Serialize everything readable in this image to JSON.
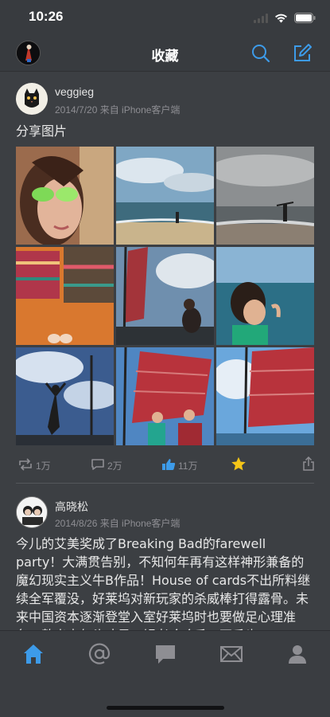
{
  "status_bar": {
    "time": "10:26"
  },
  "nav": {
    "title": "收藏"
  },
  "posts": [
    {
      "username": "veggieg",
      "meta": "2014/7/20 来自 iPhone客户端",
      "text": "分享图片",
      "photo_count": 9,
      "actions": {
        "repost": "1万",
        "comment": "2万",
        "like": "11万"
      }
    },
    {
      "username": "高晓松",
      "meta": "2014/8/26 来自 iPhone客户端",
      "text": "今儿的艾美奖成了Breaking Bad的farewell party！大满贯告别，不知何年再有这样神形兼备的魔幻现实主义牛B作品！House of cards不出所料继续全军覆没，好莱坞对新玩家的杀威棒打得露骨。未来中国资本逐渐登堂入室好莱坞时也要做足心理准备。熬出来年头才是一锅老啥啥香，不香也"
    }
  ],
  "tabs": [
    "home-icon",
    "mention-icon",
    "message-icon",
    "mail-icon",
    "profile-icon"
  ],
  "colors": {
    "accent": "#3d9be9",
    "star": "#f5c518",
    "background": "#3c3f43"
  }
}
